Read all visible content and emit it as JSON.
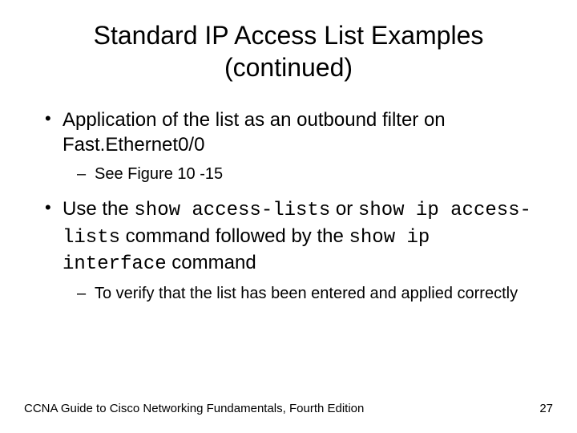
{
  "title": "Standard IP Access List Examples (continued)",
  "bullets": {
    "b1": {
      "text": "Application of the list as an outbound filter on Fast.Ethernet0/0",
      "sub1": "See Figure 10 -15"
    },
    "b2": {
      "pre": "Use the ",
      "code1": "show access-lists",
      "mid1": " or ",
      "code2": "show ip access-lists",
      "mid2": " command followed by the ",
      "code3": "show ip interface",
      "post": " command",
      "sub1": "To verify that the list has been entered and applied correctly"
    }
  },
  "footer": {
    "left": "CCNA Guide to Cisco Networking Fundamentals, Fourth Edition",
    "page": "27"
  }
}
